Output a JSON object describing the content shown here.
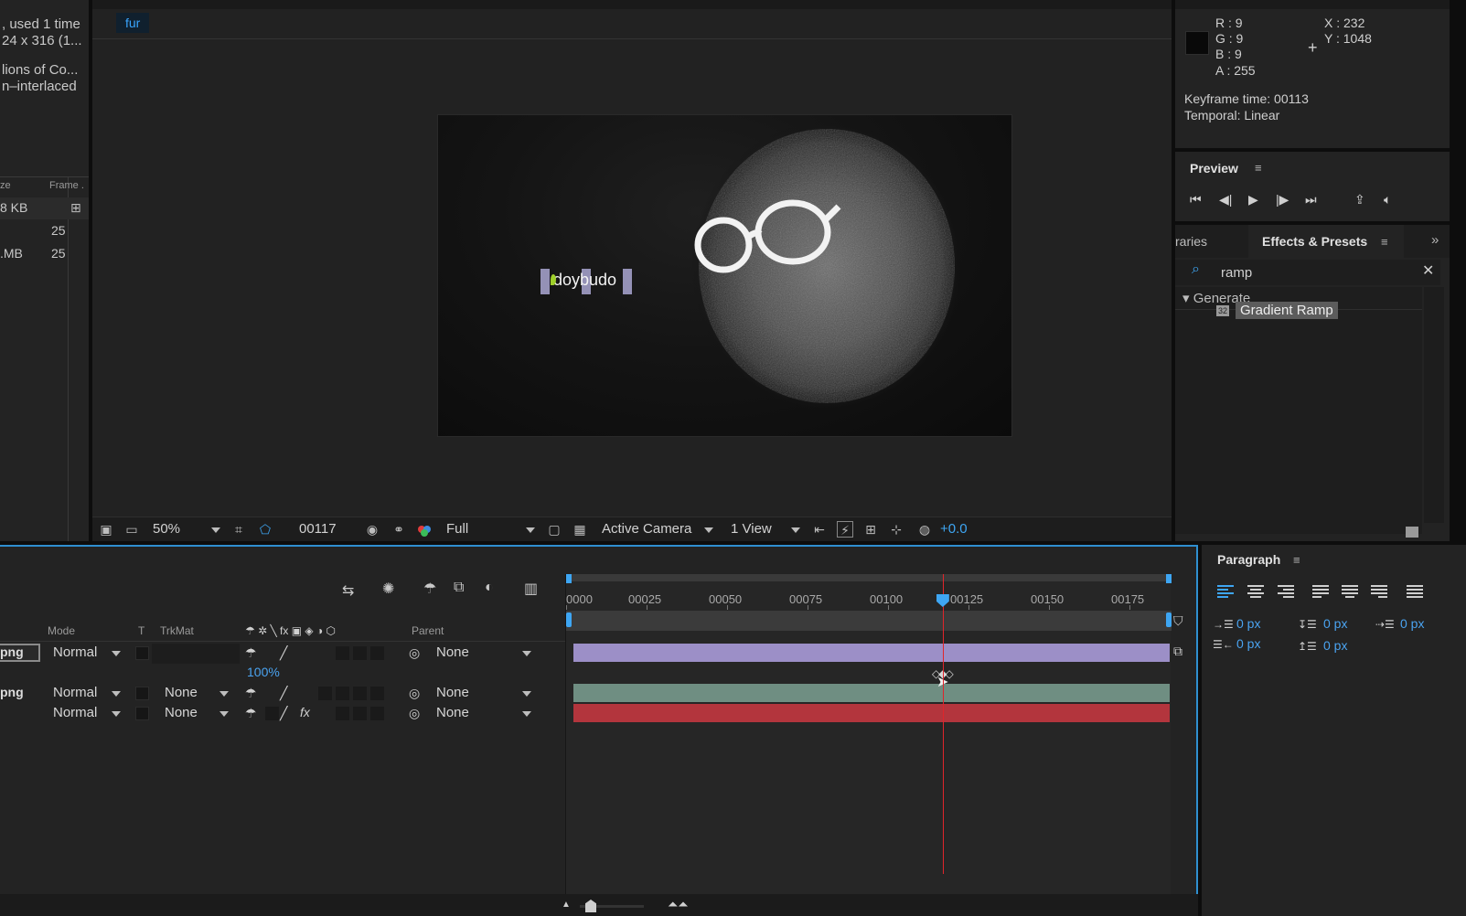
{
  "project": {
    "info_lines": [
      ", used 1 time",
      "24 x 316 (1...",
      "",
      "lions of Co...",
      "n–interlaced"
    ],
    "col_size": "ze",
    "col_frame": "Frame .",
    "rows": [
      {
        "size": "8 KB",
        "frame": ""
      },
      {
        "size": "",
        "frame": "25"
      },
      {
        "size": ".MB",
        "frame": "25"
      }
    ]
  },
  "viewer": {
    "comp_tab": "fur",
    "canvas_logo_text": "doybudo",
    "toolbar": {
      "zoom": "50%",
      "timecode": "00117",
      "resolution": "Full",
      "camera": "Active Camera",
      "views": "1 View",
      "exposure": "+0.0"
    }
  },
  "info": {
    "r": "R : 9",
    "g": "G : 9",
    "b": "B : 9",
    "a": "A : 255",
    "x": "X : 232",
    "y": "Y : 1048",
    "keyframe_time": "Keyframe time: 00113",
    "temporal": "Temporal: Linear",
    "swatch_color": "#090909"
  },
  "preview": {
    "title": "Preview",
    "buttons": [
      "skip-first-icon",
      "step-back-icon",
      "play-icon",
      "step-forward-icon",
      "skip-last-icon",
      "loop-icon",
      "audio-icon"
    ]
  },
  "effects": {
    "tab_libraries": "raries",
    "tab_effects": "Effects & Presets",
    "search_value": "ramp",
    "category": "Generate",
    "item": "Gradient Ramp"
  },
  "timeline": {
    "columns": {
      "mode": "Mode",
      "t": "T",
      "trkmat": "TrkMat",
      "parent": "Parent"
    },
    "layers": [
      {
        "name": "png",
        "mode": "Normal",
        "trkmat": "",
        "parent": "None"
      },
      {
        "name": "png",
        "mode": "Normal",
        "trkmat": "None",
        "parent": "None"
      },
      {
        "name": "",
        "mode": "Normal",
        "trkmat": "None",
        "parent": "None"
      }
    ],
    "property_value": "100%",
    "ruler": [
      "0000",
      "00025",
      "00050",
      "00075",
      "00100",
      "00125",
      "00150",
      "00175"
    ],
    "current_frame_index": 117,
    "bar_colors": [
      "#9c8fc7",
      "#6f8e82",
      "#b3353d"
    ]
  },
  "paragraph": {
    "title": "Paragraph",
    "indent_left": "0 px",
    "indent_right": "0 px",
    "indent_first": "0 px",
    "space_before": "0 px",
    "space_after": "0 px"
  }
}
